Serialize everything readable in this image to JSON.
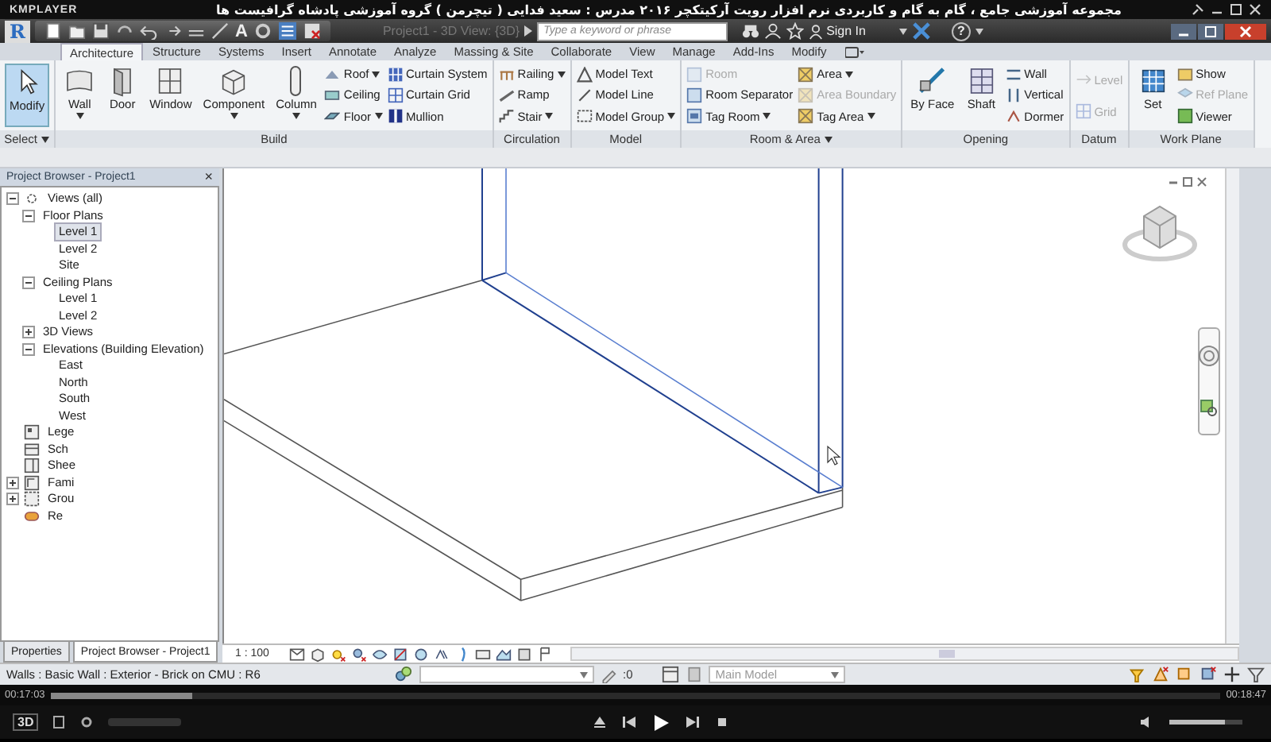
{
  "player": {
    "logo": "KMPLAYER",
    "title": "مجموعه آموزشی جامع ، گام به گام و کاربردی نرم افزار رویت آرکیتکچر ۲۰۱۶   مدرس : سعید فدایی ( تیچرمن ) گروه آموزشی پادشاه گرافیست ها",
    "elapsed": "00:17:03",
    "total": "00:18:47",
    "seek": {
      "level": 0.12
    },
    "badge": "3D",
    "volume": {
      "level": 0.75
    }
  },
  "app": {
    "logo": "R",
    "text_tool": "A",
    "document_title": "Project1 - 3D View: {3D}",
    "search": {
      "placeholder": "Type a keyword or phrase"
    },
    "sign_in": "Sign In",
    "help": "?"
  },
  "ribbon": {
    "tabs": [
      {
        "label": "Architecture",
        "selected": true
      },
      {
        "label": "Structure",
        "selected": false
      },
      {
        "label": "Systems",
        "selected": false
      },
      {
        "label": "Insert",
        "selected": false
      },
      {
        "label": "Annotate",
        "selected": false
      },
      {
        "label": "Analyze",
        "selected": false
      },
      {
        "label": "Massing & Site",
        "selected": false
      },
      {
        "label": "Collaborate",
        "selected": false
      },
      {
        "label": "View",
        "selected": false
      },
      {
        "label": "Manage",
        "selected": false
      },
      {
        "label": "Add-Ins",
        "selected": false
      },
      {
        "label": "Modify",
        "selected": false
      }
    ],
    "groups": [
      {
        "label": "Select",
        "dropdown": true,
        "items": [
          {
            "kind": "large",
            "label": "Modify",
            "active": true
          }
        ]
      },
      {
        "label": "Build",
        "items": [
          {
            "kind": "large",
            "label": "Wall",
            "dropdown": true
          },
          {
            "kind": "large",
            "label": "Door"
          },
          {
            "kind": "large",
            "label": "Window"
          },
          {
            "kind": "large",
            "label": "Component",
            "dropdown": true
          },
          {
            "kind": "large",
            "label": "Column",
            "dropdown": true
          },
          {
            "kind": "stack",
            "tools": [
              {
                "label": "Roof",
                "dropdown": true
              },
              {
                "label": "Ceiling"
              },
              {
                "label": "Floor",
                "dropdown": true
              }
            ]
          },
          {
            "kind": "stack",
            "tools": [
              {
                "label": "Curtain System"
              },
              {
                "label": "Curtain Grid"
              },
              {
                "label": "Mullion"
              }
            ]
          }
        ]
      },
      {
        "label": "Circulation",
        "items": [
          {
            "kind": "stack",
            "tools": [
              {
                "label": "Railing",
                "dropdown": true
              },
              {
                "label": "Ramp"
              },
              {
                "label": "Stair",
                "dropdown": true
              }
            ]
          }
        ]
      },
      {
        "label": "Model",
        "items": [
          {
            "kind": "stack",
            "tools": [
              {
                "label": "Model Text"
              },
              {
                "label": "Model Line"
              },
              {
                "label": "Model Group",
                "dropdown": true
              }
            ]
          }
        ]
      },
      {
        "label": "Room & Area",
        "dropdown": true,
        "items": [
          {
            "kind": "stack",
            "tools": [
              {
                "label": "Room",
                "disabled": true
              },
              {
                "label": "Room Separator"
              },
              {
                "label": "Tag Room",
                "dropdown": true
              }
            ]
          },
          {
            "kind": "stack",
            "tools": [
              {
                "label": "Area",
                "dropdown": true
              },
              {
                "label": "Area Boundary",
                "disabled": true
              },
              {
                "label": "Tag Area",
                "dropdown": true
              }
            ]
          }
        ]
      },
      {
        "label": "Opening",
        "items": [
          {
            "kind": "large",
            "label": "By Face"
          },
          {
            "kind": "large",
            "label": "Shaft"
          },
          {
            "kind": "stack",
            "tools": [
              {
                "label": "Wall"
              },
              {
                "label": "Vertical"
              },
              {
                "label": "Dormer"
              }
            ]
          }
        ]
      },
      {
        "label": "Datum",
        "items": [
          {
            "kind": "stack",
            "tools": [
              {
                "label": "Level",
                "disabled": true
              },
              {
                "label": "Grid",
                "disabled": true
              }
            ]
          }
        ]
      },
      {
        "label": "Work Plane",
        "items": [
          {
            "kind": "large",
            "label": "Set"
          },
          {
            "kind": "stack",
            "tools": [
              {
                "label": "Show"
              },
              {
                "label": "Ref Plane",
                "disabled": true
              },
              {
                "label": "Viewer"
              }
            ]
          }
        ]
      }
    ]
  },
  "browser": {
    "title": "Project Browser - Project1",
    "close": "×",
    "tree": [
      {
        "label": "Views (all)",
        "expanded": true,
        "children": [
          {
            "label": "Floor Plans",
            "expanded": true,
            "children": [
              {
                "label": "Level 1",
                "selected": true
              },
              {
                "label": "Level 2",
                "selected": false
              },
              {
                "label": "Site",
                "selected": false
              }
            ]
          },
          {
            "label": "Ceiling Plans",
            "expanded": true,
            "children": [
              {
                "label": "Level 1",
                "selected": false
              },
              {
                "label": "Level 2",
                "selected": false
              }
            ]
          },
          {
            "label": "3D Views",
            "expanded": false
          },
          {
            "label": "Elevations (Building Elevation)",
            "expanded": true,
            "children": [
              {
                "label": "East",
                "selected": false
              },
              {
                "label": "North",
                "selected": false
              },
              {
                "label": "South",
                "selected": false
              },
              {
                "label": "West",
                "selected": false
              }
            ]
          }
        ]
      },
      {
        "label": "Lege"
      },
      {
        "label": "Sch"
      },
      {
        "label": "Shee"
      },
      {
        "label": "Fami",
        "expanded": false
      },
      {
        "label": "Grou",
        "expanded": false
      },
      {
        "label": "Re"
      }
    ],
    "tabs": [
      {
        "label": "Properties",
        "selected": false
      },
      {
        "label": "Project Browser - Project1",
        "selected": true
      }
    ]
  },
  "view_bar": {
    "scale": "1 : 100"
  },
  "status_bar": {
    "text": "Walls : Basic Wall : Exterior - Brick on CMU : R6",
    "count": ":0",
    "model": "Main Model"
  }
}
